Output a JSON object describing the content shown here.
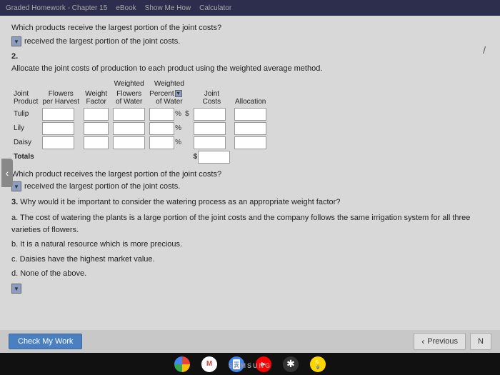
{
  "topbar": {
    "items": [
      "Graded Homework - Chapter 15",
      "eBook",
      "Show Me How",
      "Calculator"
    ]
  },
  "q1": {
    "text": "Which products receive the largest portion of the joint costs?",
    "dropdown_placeholder": "",
    "answer_text": "received the largest portion of the joint costs."
  },
  "q2": {
    "number": "2.",
    "text": "Allocate the joint costs of production to each product using the weighted average method.",
    "table": {
      "headers": {
        "col1": "Joint",
        "col2": "Flowers",
        "col3": "Weight",
        "col4_top": "Weighted",
        "col4": "Flowers",
        "col5_top": "Weighted",
        "col5": "Percent",
        "col5b": "of Water",
        "col6": "Joint",
        "col7": "Allocation",
        "col4b": "of Water",
        "col1b": "Product",
        "col2b": "per Harvest",
        "col3b": "Factor",
        "col6b": "Costs"
      },
      "rows": [
        {
          "product": "Tulip",
          "flowers": "",
          "weight": "",
          "wt_flowers": "",
          "pct_water": "",
          "joint_costs": "",
          "allocation": ""
        },
        {
          "product": "Lily",
          "flowers": "",
          "weight": "",
          "wt_flowers": "",
          "pct_water": "",
          "joint_costs": "",
          "allocation": ""
        },
        {
          "product": "Daisy",
          "flowers": "",
          "weight": "",
          "wt_flowers": "",
          "pct_water": "",
          "joint_costs": "",
          "allocation": ""
        },
        {
          "product": "Totals",
          "flowers": "",
          "weight": "",
          "wt_flowers": "",
          "pct_water": "",
          "joint_costs": "",
          "allocation": ""
        }
      ]
    },
    "which_product_q": "Which product receives the largest portion of the joint costs?",
    "answer_text": "received the largest portion of the joint costs."
  },
  "q3": {
    "number": "3.",
    "text": "Why would it be important to consider the watering process as an appropriate weight factor?",
    "options": [
      {
        "label": "a.",
        "text": "The cost of watering the plants is a large portion of the joint costs and the company follows the same irrigation system for all three varieties of flowers."
      },
      {
        "label": "b.",
        "text": "It is a natural resource which is more precious."
      },
      {
        "label": "c.",
        "text": "Daisies have the highest market value."
      },
      {
        "label": "d.",
        "text": "None of the above."
      }
    ]
  },
  "buttons": {
    "check_my_work": "Check My Work",
    "previous": "Previous",
    "next": "N"
  },
  "taskbar": {
    "icons": [
      "Chrome",
      "Gmail",
      "Docs",
      "YouTube",
      "Asterisk",
      "Bulb"
    ],
    "samsung": "SAMSUNG"
  }
}
